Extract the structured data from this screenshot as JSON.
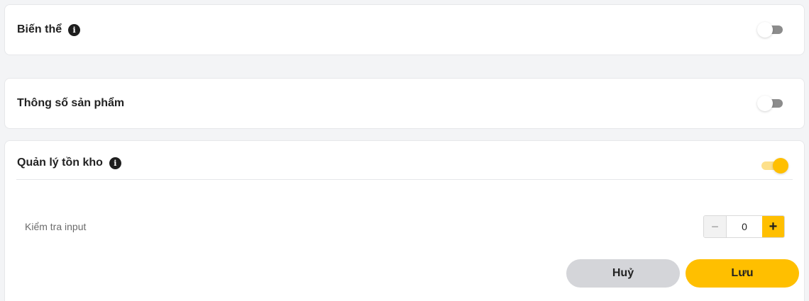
{
  "sections": {
    "variant": {
      "title": "Biến thể",
      "has_info": true,
      "toggle_on": false
    },
    "spec": {
      "title": "Thông số sản phẩm",
      "has_info": false,
      "toggle_on": false
    },
    "stock": {
      "title": "Quản lý tồn kho",
      "has_info": true,
      "toggle_on": true,
      "field_label": "Kiểm tra input",
      "stepper": {
        "minus": "−",
        "value": "0",
        "plus": "+"
      }
    }
  },
  "actions": {
    "cancel_label": "Huỷ",
    "save_label": "Lưu"
  },
  "icons": {
    "info": "info-icon"
  },
  "colors": {
    "accent": "#ffbf00",
    "accent_light": "#fde08a",
    "cancel_bg": "#d4d5d9",
    "toggle_off": "#8c8c8c"
  }
}
